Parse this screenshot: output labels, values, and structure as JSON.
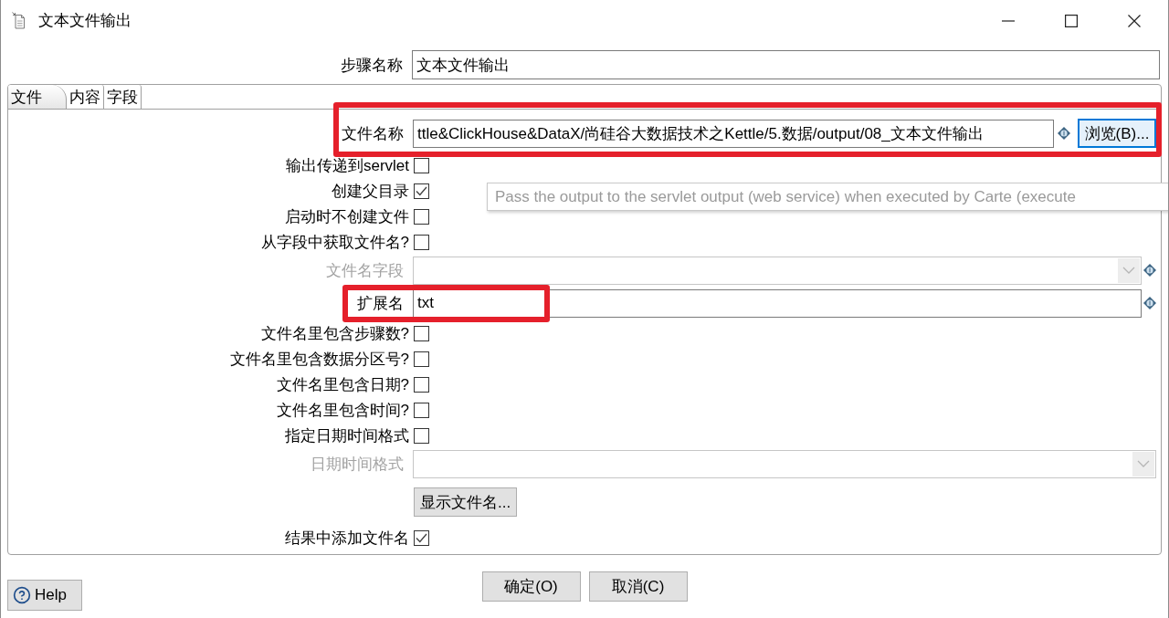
{
  "window": {
    "title": "文本文件输出"
  },
  "step_name": {
    "label": "步骤名称",
    "value": "文本文件输出"
  },
  "tabs": [
    {
      "label": "文件",
      "selected": true
    },
    {
      "label": "内容",
      "selected": false
    },
    {
      "label": "字段",
      "selected": false
    }
  ],
  "form": {
    "rows": [
      {
        "kind": "file",
        "label": "文件名称",
        "value": "ttle&ClickHouse&DataX/尚硅谷大数据技术之Kettle/5.数据/output/08_文本文件输出",
        "disabled": false,
        "variable_icon": true,
        "highlighted": true,
        "button": {
          "label": "浏览(B)...",
          "focused": true
        }
      },
      {
        "kind": "checkbox",
        "label": "输出传递到servlet",
        "checked": false
      },
      {
        "kind": "checkbox",
        "label": "创建父目录",
        "checked": true
      },
      {
        "kind": "checkbox",
        "label": "启动时不创建文件",
        "checked": false
      },
      {
        "kind": "checkbox",
        "label": "从字段中获取文件名?",
        "checked": false
      },
      {
        "kind": "combo",
        "label": "文件名字段",
        "disabled": true,
        "variable_icon": true,
        "highlighted": false
      },
      {
        "kind": "text",
        "label": "扩展名",
        "value": "txt",
        "disabled": false,
        "variable_icon": true,
        "highlighted": true
      },
      {
        "kind": "checkbox",
        "label": "文件名里包含步骤数?",
        "checked": false
      },
      {
        "kind": "checkbox",
        "label": "文件名里包含数据分区号?",
        "checked": false
      },
      {
        "kind": "checkbox",
        "label": "文件名里包含日期?",
        "checked": false
      },
      {
        "kind": "checkbox",
        "label": "文件名里包含时间?",
        "checked": false
      },
      {
        "kind": "checkbox",
        "label": "指定日期时间格式",
        "checked": false
      },
      {
        "kind": "combo",
        "label": "日期时间格式",
        "disabled": true,
        "variable_icon": false,
        "highlighted": false
      },
      {
        "kind": "button",
        "button": "显示文件名..."
      },
      {
        "kind": "checkbox",
        "label": "结果中添加文件名",
        "checked": true
      }
    ]
  },
  "tooltip": {
    "text": "Pass the output to the servlet output (web service) when executed by Carte (execute"
  },
  "footer": {
    "help": "Help",
    "buttons": [
      "确定(O)",
      "取消(C)"
    ]
  }
}
